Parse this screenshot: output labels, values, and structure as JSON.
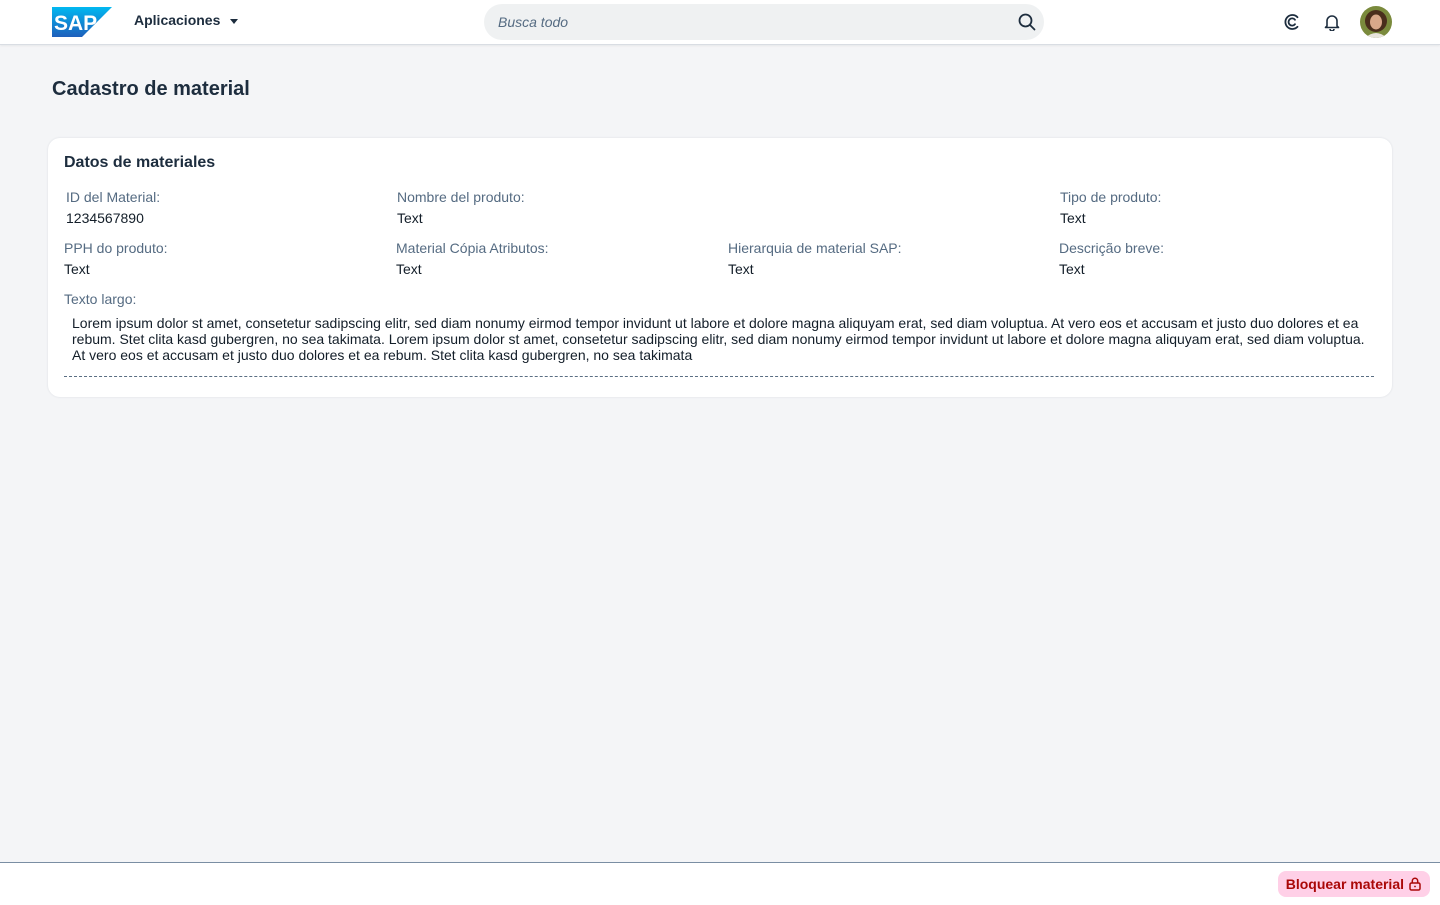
{
  "shell": {
    "logo_text": "SAP",
    "app_menu_label": "Aplicaciones",
    "search_placeholder": "Busca todo",
    "icons": [
      "search-icon",
      "joule-icon",
      "bell-icon",
      "avatar"
    ]
  },
  "page": {
    "title": "Cadastro de material"
  },
  "card": {
    "title": "Datos de materiales",
    "fields": [
      {
        "label": "ID del Material:",
        "value": "1234567890"
      },
      {
        "label": "Nombre del produto:",
        "value": "Text"
      },
      {
        "label": "Tipo de produto:",
        "value": "Text"
      },
      {
        "label": "PPH do produto:",
        "value": "Text"
      },
      {
        "label": "Material Cópia Atributos:",
        "value": "Text"
      },
      {
        "label": "Hierarquia de material SAP:",
        "value": "Text"
      },
      {
        "label": "Descrição breve:",
        "value": "Text"
      }
    ],
    "long_text_label": "Texto largo:",
    "long_text": "Lorem ipsum dolor st amet, consetetur sadipscing elitr, sed diam nonumy eirmod tempor invidunt ut labore et dolore magna aliquyam erat, sed diam voluptua. At vero eos et accusam et justo duo dolores et ea rebum. Stet clita kasd gubergren, no sea takimata. Lorem ipsum dolor st amet, consetetur sadipscing elitr, sed diam nonumy eirmod tempor invidunt ut labore et dolore magna aliquyam erat, sed diam voluptua. At vero eos et accusam et justo duo dolores et ea rebum. Stet clita kasd gubergren, no sea takimata"
  },
  "footer": {
    "lock_button_label": "Bloquear material",
    "lock_icon": "lock-icon"
  },
  "colors": {
    "brand_blue": "#0070f2",
    "page_background": "#f4f5f7",
    "negative_text": "#aa0808",
    "negative_background": "#ffd0e7"
  }
}
